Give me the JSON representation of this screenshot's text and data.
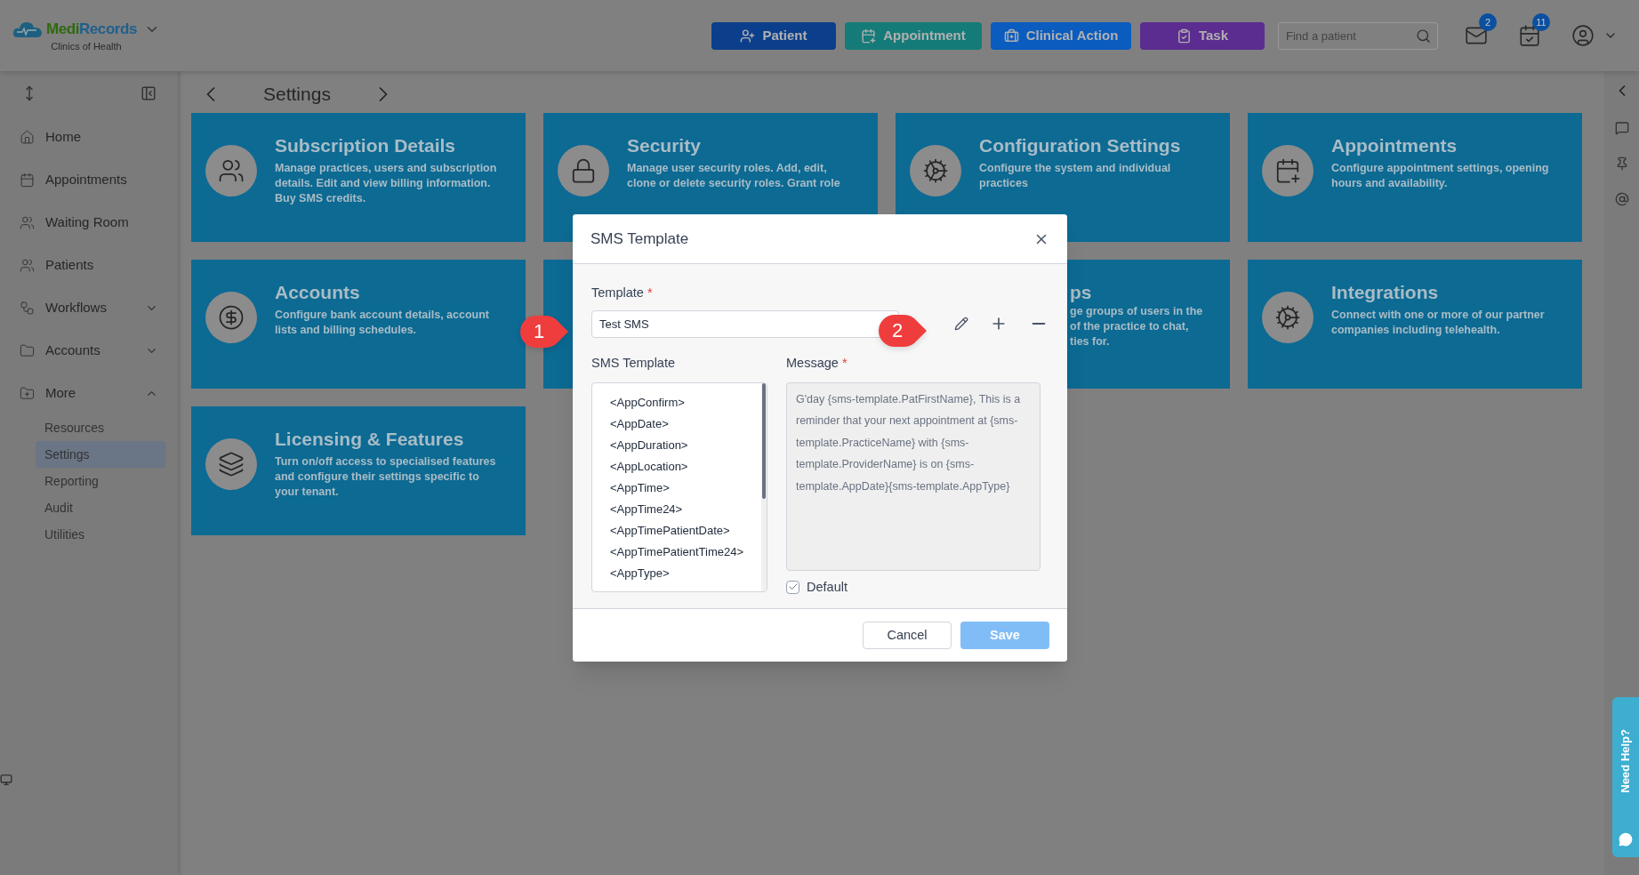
{
  "header": {
    "brand_first": "Medi",
    "brand_second": "Records",
    "subtitle": "Clinics of Health",
    "actions": [
      {
        "label": "Patient",
        "kind": "patient",
        "color": "#0b3f8c"
      },
      {
        "label": "Appointment",
        "kind": "appointment",
        "color": "#157b78"
      },
      {
        "label": "Clinical Action",
        "kind": "clinical",
        "color": "#0a5cbf"
      },
      {
        "label": "Task",
        "kind": "task",
        "color": "#5c2d91"
      }
    ],
    "search": {
      "placeholder": "Find a patient"
    },
    "notifications": [
      {
        "kind": "mail",
        "count": "2"
      },
      {
        "kind": "calendar",
        "count": "11"
      }
    ]
  },
  "sidebar": {
    "items": [
      {
        "label": "Home",
        "kind": "home"
      },
      {
        "label": "Appointments",
        "kind": "calendar"
      },
      {
        "label": "Waiting Room",
        "kind": "waiting"
      },
      {
        "label": "Patients",
        "kind": "patients"
      },
      {
        "label": "Workflows",
        "kind": "workflows",
        "expanded": false
      },
      {
        "label": "Accounts",
        "kind": "folder",
        "expanded": false
      },
      {
        "label": "More",
        "kind": "folder-plus",
        "expanded": true,
        "children": [
          {
            "label": "Resources",
            "selected": false
          },
          {
            "label": "Settings",
            "selected": true
          },
          {
            "label": "Reporting",
            "selected": false
          },
          {
            "label": "Audit",
            "selected": false
          },
          {
            "label": "Utilities",
            "selected": false
          }
        ]
      }
    ]
  },
  "breadcrumb": {
    "title": "Settings"
  },
  "cards": [
    {
      "kind": "users",
      "title": "Subscription Details",
      "description": "Manage practices, users and subscription details. Edit and view billing information. Buy SMS credits."
    },
    {
      "kind": "lock",
      "title": "Security",
      "description": "Manage user security roles. Add, edit, clone or delete security roles. Grant role"
    },
    {
      "kind": "cogs",
      "title": "Configuration Settings",
      "description": "Configure the system and individual practices"
    },
    {
      "kind": "calendar",
      "title": "Appointments",
      "description": "Configure appointment settings, opening hours and availability."
    },
    {
      "kind": "dollar",
      "title": "Accounts",
      "description": "Configure bank account details, account lists and billing schedules."
    },
    {
      "kind": "hidden"
    },
    {
      "kind": "partial",
      "title": "ps",
      "lines": [
        "ge groups of users in the",
        "of the practice to chat,",
        "ties for."
      ]
    },
    {
      "kind": "integrations",
      "title": "Integrations",
      "description": "Connect with one or more of our partner companies including telehealth."
    },
    {
      "kind": "layers",
      "title": "Licensing & Features",
      "description": "Turn on/off access to specialised features and configure their settings specific to your tenant."
    }
  ],
  "dialog": {
    "title": "SMS Template",
    "template": {
      "label": "Template",
      "required_mark": "*",
      "value": "Test SMS"
    },
    "callouts": [
      "1",
      "2"
    ],
    "sms_template": {
      "label": "SMS Template",
      "tokens": [
        "<AppConfirm>",
        "<AppDate>",
        "<AppDuration>",
        "<AppLocation>",
        "<AppTime>",
        "<AppTime24>",
        "<AppTimePatientDate>",
        "<AppTimePatientTime24>",
        "<AppType>"
      ]
    },
    "message": {
      "label": "Message",
      "required_mark": "*",
      "value": "G'day {sms-template.PatFirstName}, This is a reminder that your next appointment at {sms-template.PracticeName} with {sms-template.ProviderName} is on {sms-template.AppDate}{sms-template.AppType}"
    },
    "default": {
      "label": "Default",
      "checked": true
    },
    "buttons": [
      {
        "label": "Cancel",
        "kind": "secondary",
        "disabled": false
      },
      {
        "label": "Save",
        "kind": "primary",
        "disabled": true
      }
    ]
  },
  "help_tab": {
    "label": "Need Help?"
  }
}
